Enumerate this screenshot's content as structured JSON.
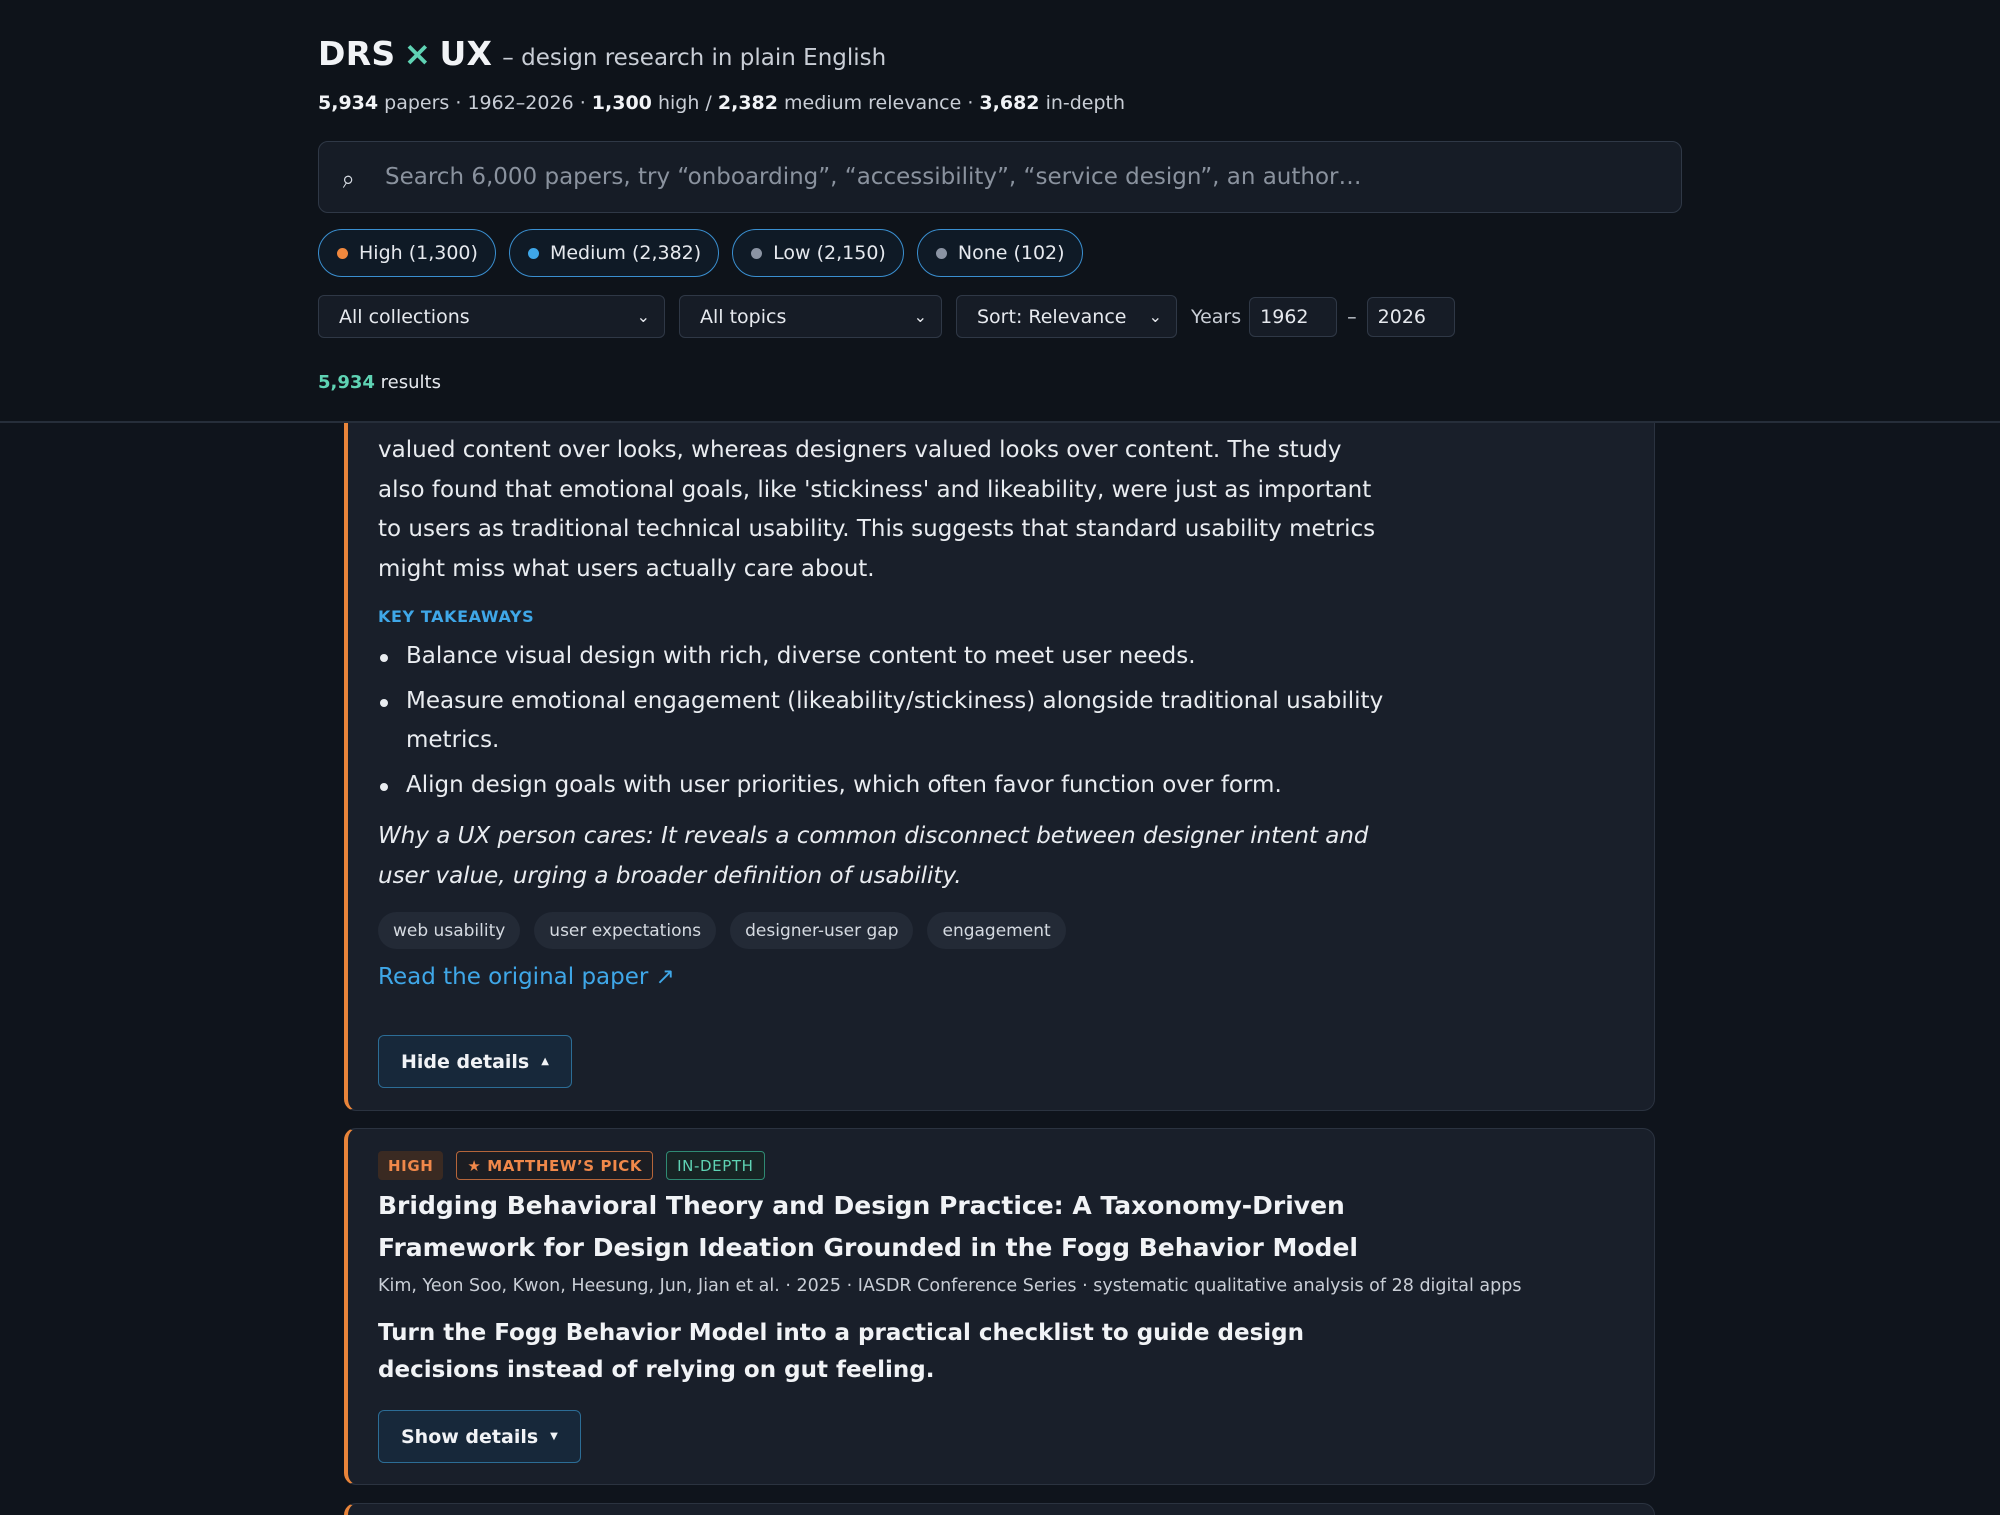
{
  "header": {
    "brand_left": "DRS",
    "brand_x": "×",
    "brand_right": "UX",
    "tagline": "– design research in plain English",
    "stats": {
      "papers_count": "5,934",
      "papers_word": "papers",
      "years": "1962–2026",
      "high_count": "1,300",
      "high_word": "high /",
      "medium_count": "2,382",
      "medium_word": "medium relevance",
      "indepth_count": "3,682",
      "indepth_word": "in-depth"
    },
    "search": {
      "icon": "search-icon",
      "placeholder": "Search 6,000 papers, try “onboarding”, “accessibility”, “service design”, an author…"
    },
    "pills": [
      {
        "label": "High (1,300)",
        "color": "#f0883e"
      },
      {
        "label": "Medium (2,382)",
        "color": "#3fa7e8"
      },
      {
        "label": "Low (2,150)",
        "color": "#8b94a3"
      },
      {
        "label": "None (102)",
        "color": "#8b94a3"
      }
    ],
    "filters": {
      "collections": "All collections",
      "topics": "All topics",
      "sort": "Sort: Relevance",
      "years_label": "Years",
      "year_from": "1962",
      "year_to": "2026",
      "year_sep": "–"
    },
    "results": {
      "count": "5,934",
      "label": "results"
    }
  },
  "card1": {
    "summary": "valued content over looks, whereas designers valued looks over content. The study also found that emotional goals, like 'stickiness' and likeability, were just as important to users as traditional technical usability. This suggests that standard usability metrics might miss what users actually care about.",
    "takeaways_label": "KEY TAKEAWAYS",
    "takeaways": [
      "Balance visual design with rich, diverse content to meet user needs.",
      "Measure emotional engagement (likeability/stickiness) alongside traditional usability metrics.",
      "Align design goals with user priorities, which often favor function over form."
    ],
    "why": "Why a UX person cares: It reveals a common disconnect between designer intent and user value, urging a broader definition of usability.",
    "tags": [
      "web usability",
      "user expectations",
      "designer-user gap",
      "engagement"
    ],
    "link": "Read the original paper ↗",
    "toggle": "Hide details",
    "toggle_icon": "▲"
  },
  "card2": {
    "badges": {
      "relevance": "HIGH",
      "pick": "★ MATTHEW’S PICK",
      "depth": "IN-DEPTH"
    },
    "title": "Bridging Behavioral Theory and Design Practice: A Taxonomy-Driven Framework for Design Ideation Grounded in the Fogg Behavior Model",
    "meta": "Kim, Yeon Soo, Kwon, Heesung, Jun, Jian et al. · 2025 · IASDR Conference Series · systematic qualitative analysis of 28 digital apps",
    "tldr": "Turn the Fogg Behavior Model into a practical checklist to guide design decisions instead of relying on gut feeling.",
    "toggle": "Show details",
    "toggle_icon": "▼"
  },
  "colors": {
    "accent_high": "#e8843a",
    "accent_link": "#3fa7e8",
    "accent_teal": "#5fd3b4"
  }
}
